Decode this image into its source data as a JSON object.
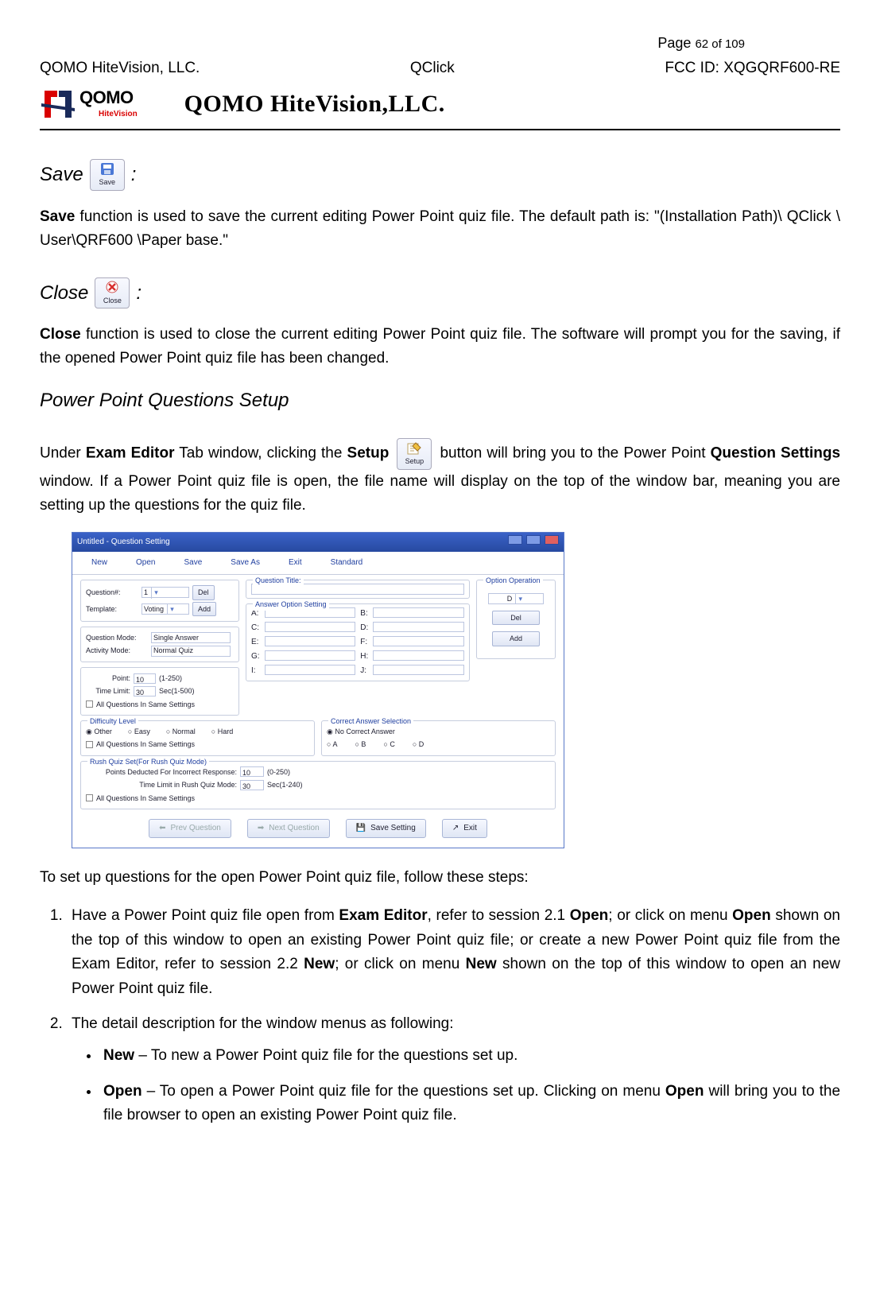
{
  "header": {
    "page_prefix": "Page ",
    "page_num": "62",
    "page_of": " of 109",
    "company_left": "QOMO HiteVision, LLC.",
    "product": "QClick",
    "fcc": "FCC ID: XQGQRF600-RE",
    "logo_text": "QOMO",
    "logo_sub": "HiteVision",
    "company_title": "QOMO HiteVision,LLC."
  },
  "save": {
    "label_prefix": "Save ",
    "colon": ":",
    "icon_caption": "Save",
    "desc_bold": "Save",
    "desc_rest": " function is used to save the current editing Power Point quiz file. The default path is: \"(Installation Path)\\ QClick \\ User\\QRF600 \\Paper base.\""
  },
  "close": {
    "label_prefix": "Close",
    "colon": ":",
    "icon_caption": "Close",
    "desc_bold": "Close",
    "desc_rest": " function is used to close the current editing Power Point quiz file. The software will prompt you for the saving, if the opened Power Point quiz file has been changed."
  },
  "setup_heading": "Power Point Questions Setup",
  "setup_para": {
    "p1": "Under ",
    "b1": "Exam Editor",
    "p2": " Tab window, clicking the ",
    "b2": "Setup",
    "icon_caption": "Setup",
    "p3": " button will bring you to the Power Point ",
    "b3": "Question Settings",
    "p4": " window. If a Power Point quiz file is open, the file name will display on the top of the window bar, meaning you are setting up the questions for the quiz file."
  },
  "screenshot": {
    "title": "Untitled - Question Setting",
    "menu": [
      "New",
      "Open",
      "Save",
      "Save As",
      "Exit",
      "Standard"
    ],
    "left": {
      "question_lbl": "Question#:",
      "question_val": "1",
      "del": "Del",
      "template_lbl": "Template:",
      "template_val": "Voting",
      "add": "Add",
      "qmode_lbl": "Question Mode:",
      "qmode_val": "Single Answer",
      "amode_lbl": "Activity Mode:",
      "amode_val": "Normal Quiz",
      "point_lbl": "Point:",
      "point_val": "10",
      "point_range": "(1-250)",
      "time_lbl": "Time Limit:",
      "time_val": "30",
      "time_unit": "Sec(1-500)",
      "all_same": "All Questions In Same Settings"
    },
    "qtitle_legend": "Question Title:",
    "ans_legend": "Answer Option Setting",
    "ans_letters": [
      "A:",
      "B:",
      "C:",
      "D:",
      "E:",
      "F:",
      "G:",
      "H:",
      "I:",
      "J:"
    ],
    "opop_legend": "Option Operation",
    "difficulty": {
      "legend": "Difficulty Level",
      "opts": [
        "Other",
        "Easy",
        "Normal",
        "Hard"
      ],
      "all_same": "All Questions In Same Settings"
    },
    "correct": {
      "legend": "Correct Answer Selection",
      "none": "No Correct Answer",
      "opts": [
        "A",
        "B",
        "C",
        "D"
      ]
    },
    "rush": {
      "legend": "Rush Quiz Set(For Rush Quiz Mode)",
      "pts_lbl": "Points Deducted For Incorrect Response:",
      "pts_val": "10",
      "pts_range": "(0-250)",
      "time_lbl": "Time Limit in Rush Quiz Mode:",
      "time_val": "30",
      "time_range": "Sec(1-240)",
      "all_same": "All Questions In Same Settings"
    },
    "buttons": {
      "prev": "Prev Question",
      "next": "Next Question",
      "save": "Save Setting",
      "exit": "Exit"
    }
  },
  "followup_intro": "To set up questions for the open Power Point quiz file, follow these steps:",
  "steps": {
    "s1a": "Have a Power Point quiz file open from ",
    "s1b": "Exam Editor",
    "s1c": ", refer to session 2.1 ",
    "s1d": "Open",
    "s1e": "; or click on menu ",
    "s1f": "Open",
    "s1g": " shown on the top of this window to open an existing Power Point quiz file; or create a new Power Point quiz file from the Exam Editor, refer to session 2.2 ",
    "s1h": "New",
    "s1i": "; or click on menu ",
    "s1j": "New",
    "s1k": " shown on the top of this window to open an new Power Point quiz file.",
    "s2": "The detail description for the window menus as following:",
    "b1a": "New",
    "b1b": " – To new a Power Point quiz file for the questions set up.",
    "b2a": "Open",
    "b2b": " – To open a Power Point quiz file for the questions set up. Clicking on menu ",
    "b2c": "Open",
    "b2d": " will bring you to the file browser to open an existing Power Point quiz file."
  }
}
